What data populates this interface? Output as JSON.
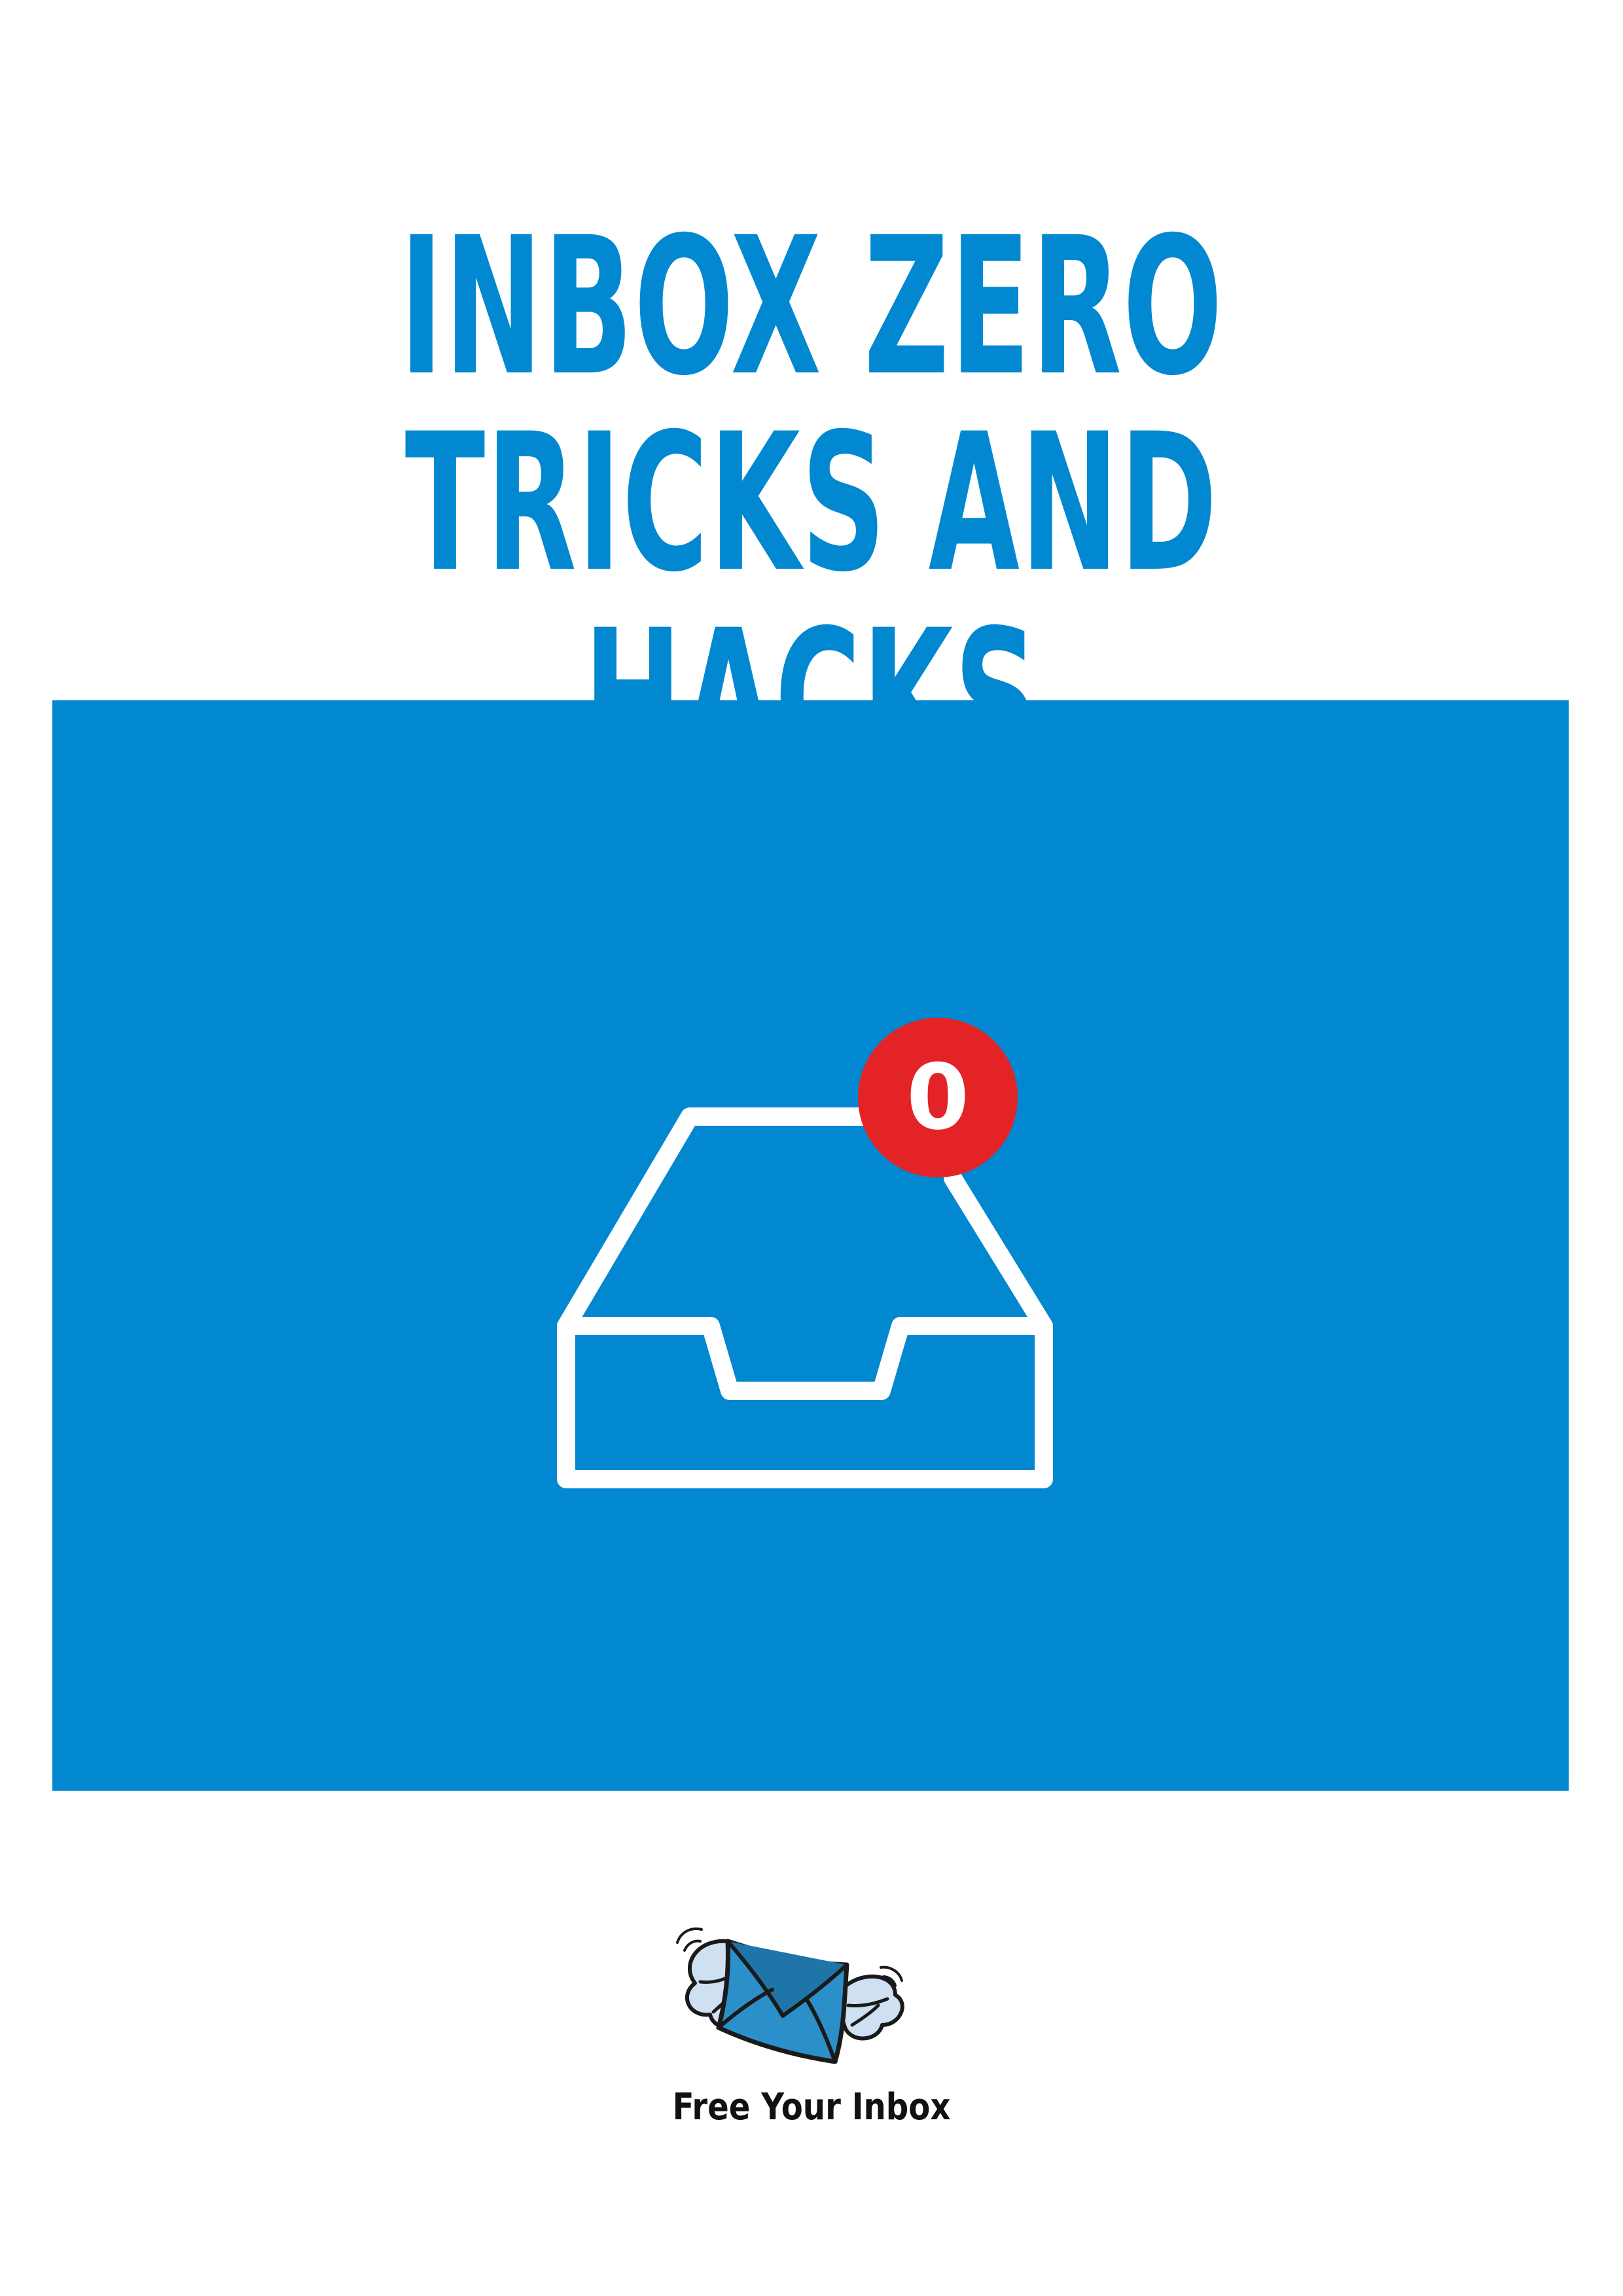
{
  "title": {
    "line1": "INBOX ZERO",
    "line2": "TRICKS AND HACKS"
  },
  "hero": {
    "icon": "inbox-tray-icon",
    "badge_count": "0"
  },
  "brand": {
    "logo": "winged-envelope-logo",
    "name": "Free Your Inbox"
  },
  "colors": {
    "accent": "#0288d1",
    "badge": "#e32326",
    "icon_stroke": "#ffffff"
  }
}
